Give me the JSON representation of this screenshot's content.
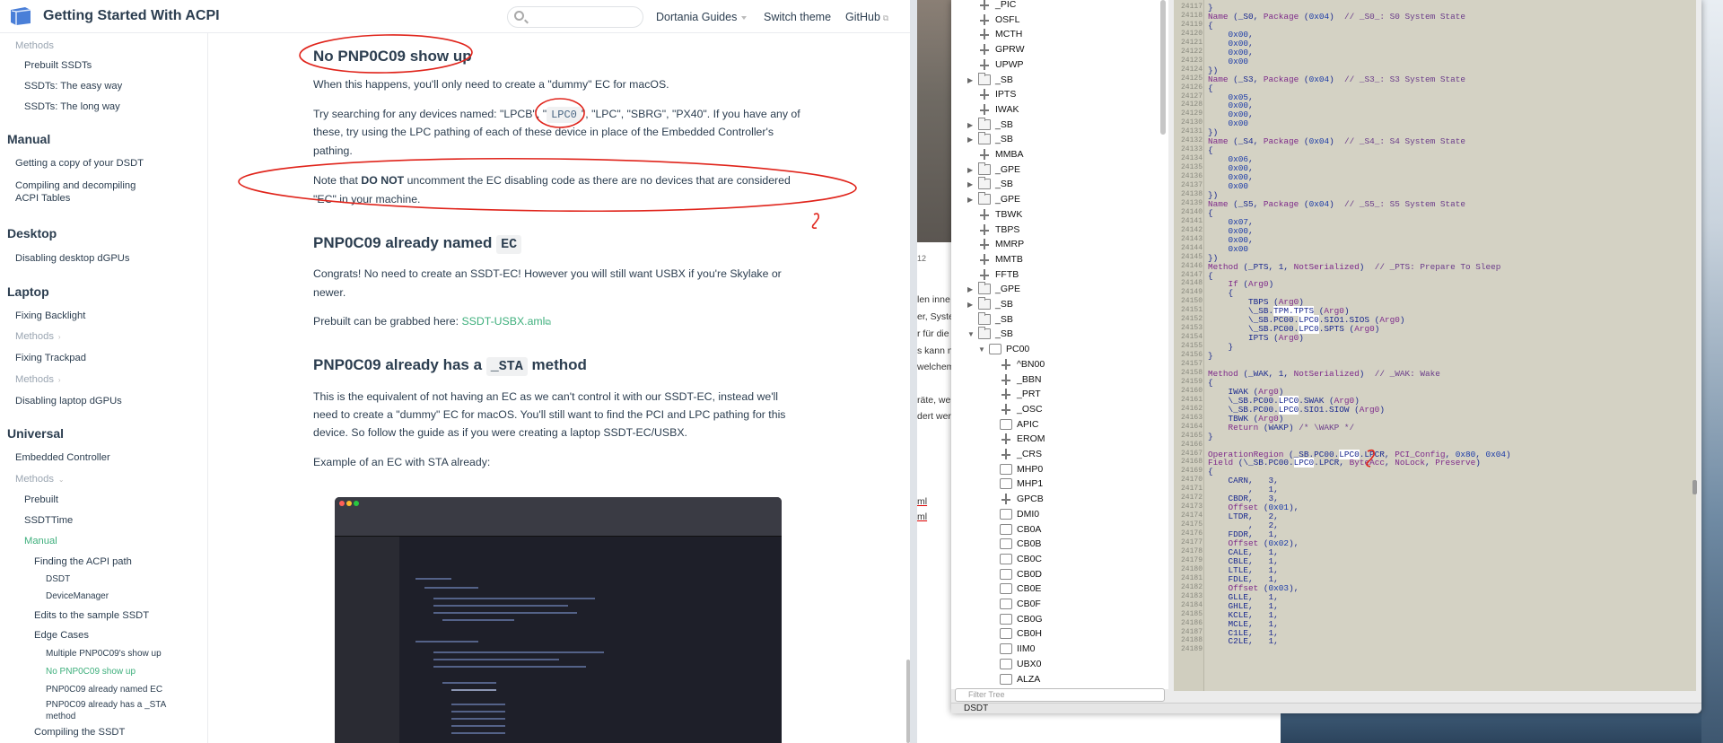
{
  "browser": {
    "site_title": "Getting Started With ACPI",
    "search_placeholder": "",
    "nav": {
      "guides": "Dortania Guides",
      "theme": "Switch theme",
      "github": "GitHub"
    }
  },
  "sidebar": {
    "methods_top": "Methods",
    "prebuilt_ssdts": "Prebuilt SSDTs",
    "ssdts_easy": "SSDTs: The easy way",
    "ssdts_long": "SSDTs: The long way",
    "manual_heading": "Manual",
    "copy_dsdt": "Getting a copy of your DSDT",
    "compiling_acpi": "Compiling and decompiling ACPI Tables",
    "desktop_heading": "Desktop",
    "disabling_desktop": "Disabling desktop dGPUs",
    "laptop_heading": "Laptop",
    "fixing_backlight": "Fixing Backlight",
    "methods_1": "Methods",
    "fixing_trackpad": "Fixing Trackpad",
    "methods_2": "Methods",
    "disabling_laptop": "Disabling laptop dGPUs",
    "universal_heading": "Universal",
    "embedded_controller": "Embedded Controller",
    "methods_3": "Methods",
    "prebuilt": "Prebuilt",
    "ssdttime": "SSDTTime",
    "manual": "Manual",
    "finding_acpi": "Finding the ACPI path",
    "dsdt": "DSDT",
    "device_manager": "DeviceManager",
    "edits_sample": "Edits to the sample SSDT",
    "edge_cases": "Edge Cases",
    "multiple_pnp": "Multiple PNP0C09's show up",
    "no_pnp": "No PNP0C09 show up",
    "already_named": "PNP0C09 already named EC",
    "already_sta": "PNP0C09 already has a _STA method",
    "compiling_ssdt": "Compiling the SSDT"
  },
  "content": {
    "h_no_pnp": "No PNP0C09 show up",
    "p1": "When this happens, you'll only need to create a \"dummy\" EC for macOS.",
    "p2_a": "Try searching for any devices named: \"LPCB\", \"",
    "p2_lpc0": "LPC0",
    "p2_b": "\", \"LPC\", \"SBRG\", \"PX40\". If you have any of",
    "p2_c": "these, try using the LPC pathing of each of these device in place of the Embedded Controller's",
    "p2_d": "pathing.",
    "p3_a": "Note that ",
    "p3_bold": "DO NOT",
    "p3_b": " uncomment the EC disabling code as there are no devices that are considered",
    "p3_c": "\"EC\" in your machine.",
    "h_named": "PNP0C09 already named",
    "h_named_code": "EC",
    "p4_a": "Congrats! No need to create an SSDT-EC! However you will still want USBX if you're Skylake or",
    "p4_b": "newer.",
    "p5_a": "Prebuilt can be grabbed here: ",
    "p5_link": "SSDT-USBX.aml",
    "h_sta_a": "PNP0C09 already has a",
    "h_sta_code": "_STA",
    "h_sta_b": "method",
    "p6_a": "This is the equivalent of not having an EC as we can't control it with our SSDT-EC, instead we'll",
    "p6_b": "need to create a \"dummy\" EC for macOS. You'll still want to find the PCI and LPC pathing for this",
    "p6_c": "device. So follow the guide as if you were creating a laptop SSDT-EC/USBX.",
    "p7": "Example of an EC with STA already:"
  },
  "middle": {
    "num": "12",
    "t1": "len inne",
    "t2": "er, Syste",
    "t3": "r für die",
    "t4": "s kann n",
    "t5": "welchem",
    "t6": "räte, we",
    "t7": "dert wer",
    "t8": "ml",
    "t9": "ml"
  },
  "iasl": {
    "filter_placeholder": "Filter Tree",
    "tab": "DSDT",
    "tree": [
      {
        "label": "_PIC",
        "icon": "net",
        "indent": 0,
        "arrow": ""
      },
      {
        "label": "OSFL",
        "icon": "net",
        "indent": 0,
        "arrow": ""
      },
      {
        "label": "MCTH",
        "icon": "net",
        "indent": 0,
        "arrow": ""
      },
      {
        "label": "GPRW",
        "icon": "net",
        "indent": 0,
        "arrow": ""
      },
      {
        "label": "UPWP",
        "icon": "net",
        "indent": 0,
        "arrow": ""
      },
      {
        "label": "_SB",
        "icon": "fold",
        "indent": 0,
        "arrow": "▶"
      },
      {
        "label": "IPTS",
        "icon": "net",
        "indent": 0,
        "arrow": ""
      },
      {
        "label": "IWAK",
        "icon": "net",
        "indent": 0,
        "arrow": ""
      },
      {
        "label": "_SB",
        "icon": "fold",
        "indent": 0,
        "arrow": "▶"
      },
      {
        "label": "_SB",
        "icon": "fold",
        "indent": 0,
        "arrow": "▶"
      },
      {
        "label": "MMBA",
        "icon": "net",
        "indent": 0,
        "arrow": ""
      },
      {
        "label": "_GPE",
        "icon": "fold",
        "indent": 0,
        "arrow": "▶"
      },
      {
        "label": "_SB",
        "icon": "fold",
        "indent": 0,
        "arrow": "▶"
      },
      {
        "label": "_GPE",
        "icon": "fold",
        "indent": 0,
        "arrow": "▶"
      },
      {
        "label": "TBWK",
        "icon": "net",
        "indent": 0,
        "arrow": ""
      },
      {
        "label": "TBPS",
        "icon": "net",
        "indent": 0,
        "arrow": ""
      },
      {
        "label": "MMRP",
        "icon": "net",
        "indent": 0,
        "arrow": ""
      },
      {
        "label": "MMTB",
        "icon": "net",
        "indent": 0,
        "arrow": ""
      },
      {
        "label": "FFTB",
        "icon": "net",
        "indent": 0,
        "arrow": ""
      },
      {
        "label": "_GPE",
        "icon": "fold",
        "indent": 0,
        "arrow": "▶"
      },
      {
        "label": "_SB",
        "icon": "fold",
        "indent": 0,
        "arrow": "▶"
      },
      {
        "label": "_SB",
        "icon": "fold",
        "indent": 0,
        "arrow": ""
      },
      {
        "label": "_SB",
        "icon": "fold",
        "indent": 0,
        "arrow": "▼"
      },
      {
        "label": "PC00",
        "icon": "box",
        "indent": 1,
        "arrow": "▼"
      },
      {
        "label": "^BN00",
        "icon": "net",
        "indent": 2,
        "arrow": ""
      },
      {
        "label": "_BBN",
        "icon": "net",
        "indent": 2,
        "arrow": ""
      },
      {
        "label": "_PRT",
        "icon": "net",
        "indent": 2,
        "arrow": ""
      },
      {
        "label": "_OSC",
        "icon": "net",
        "indent": 2,
        "arrow": ""
      },
      {
        "label": "APIC",
        "icon": "box",
        "indent": 2,
        "arrow": ""
      },
      {
        "label": "EROM",
        "icon": "net",
        "indent": 2,
        "arrow": ""
      },
      {
        "label": "_CRS",
        "icon": "net",
        "indent": 2,
        "arrow": ""
      },
      {
        "label": "MHP0",
        "icon": "box",
        "indent": 2,
        "arrow": ""
      },
      {
        "label": "MHP1",
        "icon": "box",
        "indent": 2,
        "arrow": ""
      },
      {
        "label": "GPCB",
        "icon": "net",
        "indent": 2,
        "arrow": ""
      },
      {
        "label": "DMI0",
        "icon": "box",
        "indent": 2,
        "arrow": ""
      },
      {
        "label": "CB0A",
        "icon": "box",
        "indent": 2,
        "arrow": ""
      },
      {
        "label": "CB0B",
        "icon": "box",
        "indent": 2,
        "arrow": ""
      },
      {
        "label": "CB0C",
        "icon": "box",
        "indent": 2,
        "arrow": ""
      },
      {
        "label": "CB0D",
        "icon": "box",
        "indent": 2,
        "arrow": ""
      },
      {
        "label": "CB0E",
        "icon": "box",
        "indent": 2,
        "arrow": ""
      },
      {
        "label": "CB0F",
        "icon": "box",
        "indent": 2,
        "arrow": ""
      },
      {
        "label": "CB0G",
        "icon": "box",
        "indent": 2,
        "arrow": ""
      },
      {
        "label": "CB0H",
        "icon": "box",
        "indent": 2,
        "arrow": ""
      },
      {
        "label": "IIM0",
        "icon": "box",
        "indent": 2,
        "arrow": ""
      },
      {
        "label": "UBX0",
        "icon": "box",
        "indent": 2,
        "arrow": ""
      },
      {
        "label": "ALZA",
        "icon": "box",
        "indent": 2,
        "arrow": ""
      }
    ],
    "code": [
      {
        "n": "24117",
        "t": "}"
      },
      {
        "n": "24118",
        "t": "Name (_S0, Package (0x04)  // _S0_: S0 System State"
      },
      {
        "n": "24119",
        "t": "{"
      },
      {
        "n": "24120",
        "t": "    0x00,"
      },
      {
        "n": "24121",
        "t": "    0x00,"
      },
      {
        "n": "24122",
        "t": "    0x00,"
      },
      {
        "n": "24123",
        "t": "    0x00"
      },
      {
        "n": "24124",
        "t": "})"
      },
      {
        "n": "24125",
        "t": "Name (_S3, Package (0x04)  // _S3_: S3 System State"
      },
      {
        "n": "24126",
        "t": "{"
      },
      {
        "n": "24127",
        "t": "    0x05,"
      },
      {
        "n": "24128",
        "t": "    0x00,"
      },
      {
        "n": "24129",
        "t": "    0x00,"
      },
      {
        "n": "24130",
        "t": "    0x00"
      },
      {
        "n": "24131",
        "t": "})"
      },
      {
        "n": "24132",
        "t": "Name (_S4, Package (0x04)  // _S4_: S4 System State"
      },
      {
        "n": "24133",
        "t": "{"
      },
      {
        "n": "24134",
        "t": "    0x06,"
      },
      {
        "n": "24135",
        "t": "    0x00,"
      },
      {
        "n": "24136",
        "t": "    0x00,"
      },
      {
        "n": "24137",
        "t": "    0x00"
      },
      {
        "n": "24138",
        "t": "})"
      },
      {
        "n": "24139",
        "t": "Name (_S5, Package (0x04)  // _S5_: S5 System State"
      },
      {
        "n": "24140",
        "t": "{"
      },
      {
        "n": "24141",
        "t": "    0x07,"
      },
      {
        "n": "24142",
        "t": "    0x00,"
      },
      {
        "n": "24143",
        "t": "    0x00,"
      },
      {
        "n": "24144",
        "t": "    0x00"
      },
      {
        "n": "24145",
        "t": "})"
      },
      {
        "n": "24146",
        "t": "Method (_PTS, 1, NotSerialized)  // _PTS: Prepare To Sleep"
      },
      {
        "n": "24147",
        "t": "{"
      },
      {
        "n": "24148",
        "t": "    If (Arg0)"
      },
      {
        "n": "24149",
        "t": "    {"
      },
      {
        "n": "24150",
        "t": "        TBPS (Arg0)"
      },
      {
        "n": "24151",
        "t": "        \\_SB.TPM.TPTS (Arg0)"
      },
      {
        "n": "24152",
        "t": "        \\_SB.PC00.LPC0.SIO1.SIOS (Arg0)"
      },
      {
        "n": "24153",
        "t": "        \\_SB.PC00.LPC0.SPTS (Arg0)"
      },
      {
        "n": "24154",
        "t": "        IPTS (Arg0)"
      },
      {
        "n": "24155",
        "t": "    }"
      },
      {
        "n": "24156",
        "t": "}"
      },
      {
        "n": "24157",
        "t": ""
      },
      {
        "n": "24158",
        "t": "Method (_WAK, 1, NotSerialized)  // _WAK: Wake"
      },
      {
        "n": "24159",
        "t": "{"
      },
      {
        "n": "24160",
        "t": "    IWAK (Arg0)"
      },
      {
        "n": "24161",
        "t": "    \\_SB.PC00.LPC0.SWAK (Arg0)"
      },
      {
        "n": "24162",
        "t": "    \\_SB.PC00.LPC0.SIO1.SIOW (Arg0)"
      },
      {
        "n": "24163",
        "t": "    TBWK (Arg0)"
      },
      {
        "n": "24164",
        "t": "    Return (WAKP) /* \\WAKP */"
      },
      {
        "n": "24165",
        "t": "}"
      },
      {
        "n": "24166",
        "t": ""
      },
      {
        "n": "24167",
        "t": "OperationRegion (_SB.PC00.LPC0.LPCR, PCI_Config, 0x80, 0x04)"
      },
      {
        "n": "24168",
        "t": "Field (\\_SB.PC00.LPC0.LPCR, ByteAcc, NoLock, Preserve)"
      },
      {
        "n": "24169",
        "t": "{"
      },
      {
        "n": "24170",
        "t": "    CARN,   3,"
      },
      {
        "n": "24171",
        "t": "        ,   1,"
      },
      {
        "n": "24172",
        "t": "    CBDR,   3,"
      },
      {
        "n": "24173",
        "t": "    Offset (0x01),"
      },
      {
        "n": "24174",
        "t": "    LTDR,   2,"
      },
      {
        "n": "24175",
        "t": "        ,   2,"
      },
      {
        "n": "24176",
        "t": "    FDDR,   1,"
      },
      {
        "n": "24177",
        "t": "    Offset (0x02),"
      },
      {
        "n": "24178",
        "t": "    CALE,   1,"
      },
      {
        "n": "24179",
        "t": "    CBLE,   1,"
      },
      {
        "n": "24180",
        "t": "    LTLE,   1,"
      },
      {
        "n": "24181",
        "t": "    FDLE,   1,"
      },
      {
        "n": "24182",
        "t": "    Offset (0x03),"
      },
      {
        "n": "24183",
        "t": "    GLLE,   1,"
      },
      {
        "n": "24184",
        "t": "    GHLE,   1,"
      },
      {
        "n": "24185",
        "t": "    KCLE,   1,"
      },
      {
        "n": "24186",
        "t": "    MCLE,   1,"
      },
      {
        "n": "24187",
        "t": "    C1LE,   1,"
      },
      {
        "n": "24188",
        "t": "    C2LE,   1,"
      },
      {
        "n": "24189",
        "t": ""
      }
    ]
  },
  "colors": {
    "accent": "#3eaf7c",
    "annotation": "#e0241b",
    "highlight": "#f5f000"
  }
}
